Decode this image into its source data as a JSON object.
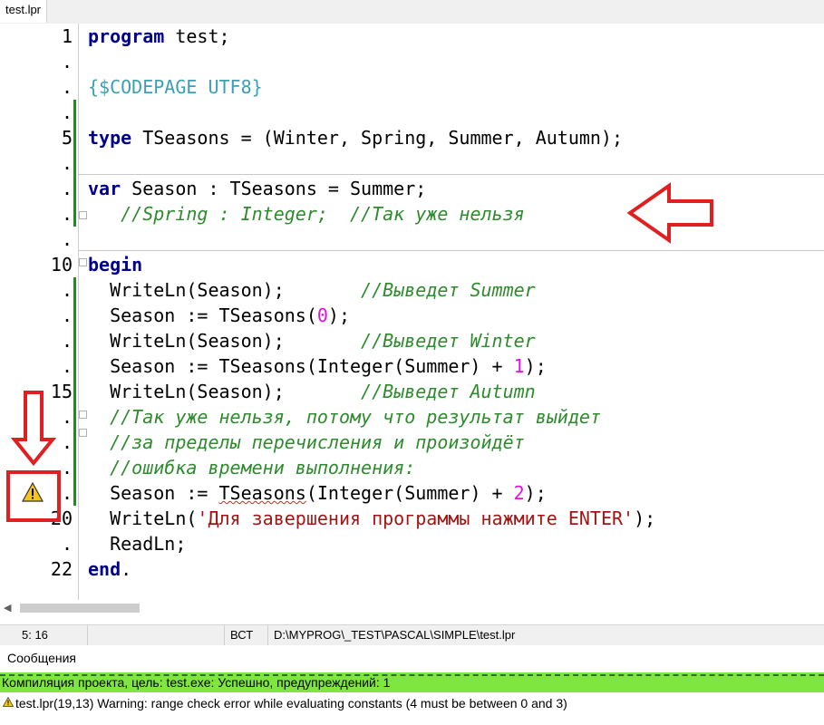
{
  "tab": {
    "label": "test.lpr"
  },
  "gutter": {
    "line_numbers": [
      "1",
      ".",
      ".",
      ".",
      "5",
      ".",
      ".",
      ".",
      ".",
      "10",
      ".",
      ".",
      ".",
      ".",
      "15",
      ".",
      ".",
      ".",
      ".",
      "20",
      ".",
      "22"
    ],
    "warning_icon": "warning-icon"
  },
  "code": {
    "l1": {
      "kw": "program",
      "rest": " test;"
    },
    "l3": {
      "directive": "{$CODEPAGE UTF8}"
    },
    "l5": {
      "kw": "type",
      "rest": " TSeasons = (Winter, Spring, Summer, Autumn);"
    },
    "l7": {
      "kw": "var",
      "rest": " Season : TSeasons = Summer;"
    },
    "l8": {
      "indent": "   ",
      "comment": "//Spring : Integer;  //Так уже нельзя"
    },
    "l10": {
      "kw": "begin"
    },
    "l11": {
      "code": "  WriteLn(Season);       ",
      "comment": "//Выведет Summer"
    },
    "l12": {
      "pre": "  Season := TSeasons(",
      "num": "0",
      "post": ");"
    },
    "l13": {
      "code": "  WriteLn(Season);       ",
      "comment": "//Выведет Winter"
    },
    "l14": {
      "pre": "  Season := TSeasons(Integer(Summer) + ",
      "num": "1",
      "post": ");"
    },
    "l15": {
      "code": "  WriteLn(Season);       ",
      "comment": "//Выведет Autumn"
    },
    "l16": {
      "indent": "  ",
      "comment": "//Так уже нельзя, потому что результат выйдет"
    },
    "l17": {
      "indent": "  ",
      "comment": "//за пределы перечисления и произойдёт"
    },
    "l18": {
      "indent": "  ",
      "comment": "//ошибка времени выполнения:"
    },
    "l19": {
      "pre": "  Season := ",
      "underlined": "TSeasons",
      "mid": "(Integer(Summer) + ",
      "num": "2",
      "post": ");"
    },
    "l20": {
      "pre": "  WriteLn(",
      "string": "'Для завершения программы нажмите ENTER'",
      "post": ");"
    },
    "l21": {
      "code": "  ReadLn;"
    },
    "l22": {
      "kw": "end",
      "rest": "."
    }
  },
  "status": {
    "position": "5: 16",
    "mode": "ВСТ",
    "path": "D:\\MYPROG\\_TEST\\PASCAL\\SIMPLE\\test.lpr"
  },
  "messages": {
    "title": "Сообщения",
    "success": "Компиляция проекта, цель: test.exe: Успешно, предупреждений: 1",
    "warning": "test.lpr(19,13) Warning: range check error while evaluating constants (4 must be between 0 and 3)"
  },
  "colors": {
    "keyword": "#00008b",
    "comment": "#2e8b2e",
    "directive": "#3ca0b4",
    "number": "#e010e0",
    "string": "#a51414",
    "modified_bar": "#1e8c1e",
    "success_bg": "#7fe63f",
    "annotation_red": "#e02020"
  }
}
